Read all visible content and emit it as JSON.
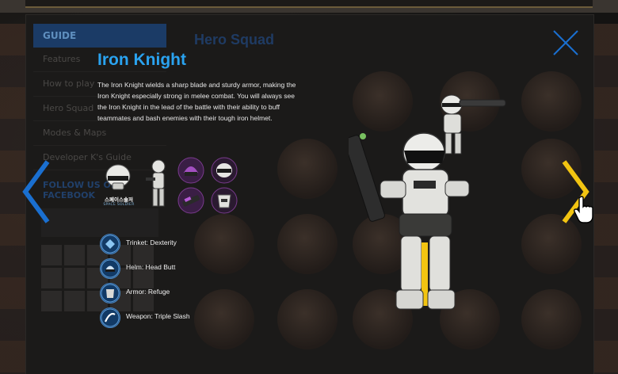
{
  "background_page": {
    "sidebar_header": "GUIDE",
    "sidebar_items": [
      "Features",
      "How to play",
      "Hero Squad",
      "Modes & Maps",
      "Developer K's Guide"
    ],
    "follow_label": "FOLLOW US ON FACEBOOK",
    "page_title": "Hero Squad"
  },
  "hero": {
    "name": "Iron Knight",
    "description": "The Iron Knight wields a sharp blade and sturdy armor, making the Iron Knight especially strong in melee combat. You will always see the Iron Knight in the lead of the battle with their ability to buff teammates and bash enemies with their tough iron helmet.",
    "set_badge_korean": "스페이스솔저",
    "set_badge_english": "SPACE SOLDIER",
    "items": [
      {
        "label": "Trinket: Dexterity",
        "icon": "trinket-icon"
      },
      {
        "label": "Helm: Head Butt",
        "icon": "helm-icon"
      },
      {
        "label": "Armor: Refuge",
        "icon": "armor-icon"
      },
      {
        "label": "Weapon: Triple Slash",
        "icon": "weapon-icon"
      }
    ]
  },
  "controls": {
    "close_icon": "close-icon",
    "prev_icon": "chevron-left-icon",
    "next_icon": "chevron-right-icon",
    "accent_blue": "#1a6fd0",
    "accent_yellow": "#f2c411"
  }
}
